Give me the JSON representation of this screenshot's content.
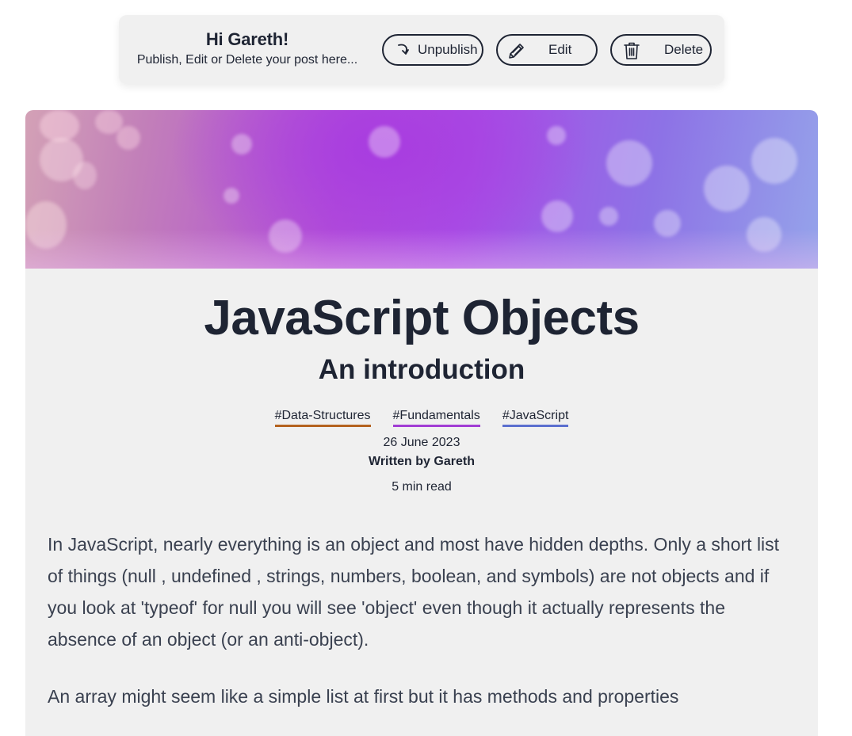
{
  "admin_bar": {
    "greeting": "Hi Gareth!",
    "subtitle": "Publish, Edit or Delete your post here...",
    "buttons": {
      "unpublish": "Unpublish",
      "edit": "Edit",
      "delete": "Delete"
    },
    "icons": {
      "unpublish": "undo-arrow-icon",
      "edit": "pencil-icon",
      "delete": "trash-icon"
    }
  },
  "post": {
    "banner": "abstract-purple-bokeh-banner",
    "title": "JavaScript Objects",
    "subtitle": "An introduction",
    "tags": [
      {
        "label": "#Data-Structures",
        "color": "#b4621f"
      },
      {
        "label": "#Fundamentals",
        "color": "#a13dd4"
      },
      {
        "label": "#JavaScript",
        "color": "#5b6fcf"
      }
    ],
    "date": "26 June 2023",
    "author": "Written by Gareth",
    "read_time": "5 min read",
    "paragraphs": [
      "In JavaScript, nearly everything is an object and most have hidden depths. Only a short list of things (null , undefined , strings, numbers, boolean, and symbols) are not objects and if you look at 'typeof' for null you will see 'object' even though it actually represents the absence of an object (or an anti-object).",
      "An array might seem like a simple list at first but it has methods and properties"
    ]
  }
}
